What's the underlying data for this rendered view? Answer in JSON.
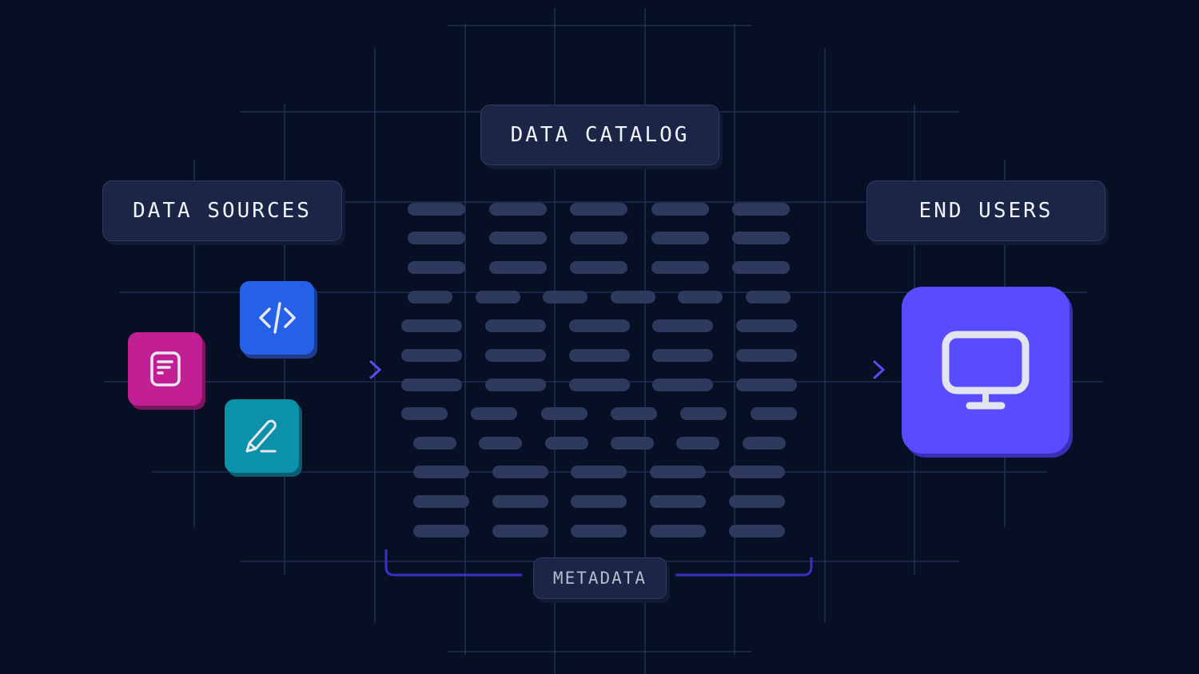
{
  "labels": {
    "sources": "DATA SOURCES",
    "catalog": "DATA CATALOG",
    "users": "END USERS",
    "metadata": "METADATA"
  },
  "sources": [
    {
      "name": "document",
      "icon": "document-icon",
      "color": "#c21f95"
    },
    {
      "name": "code",
      "icon": "code-icon",
      "color": "#2461e6"
    },
    {
      "name": "edit",
      "icon": "pencil-icon",
      "color": "#0b91aa"
    }
  ],
  "end_user": {
    "icon": "monitor-icon",
    "color": "#594cff"
  },
  "colors": {
    "background": "#070f24",
    "box": "#1b2545",
    "grid_line": "#26335a",
    "pill": "#2d3a5e",
    "accent": "#4b3fe0"
  },
  "catalog_rows": [
    5,
    5,
    5,
    6,
    5,
    5,
    5,
    6,
    6,
    5,
    5,
    5
  ]
}
